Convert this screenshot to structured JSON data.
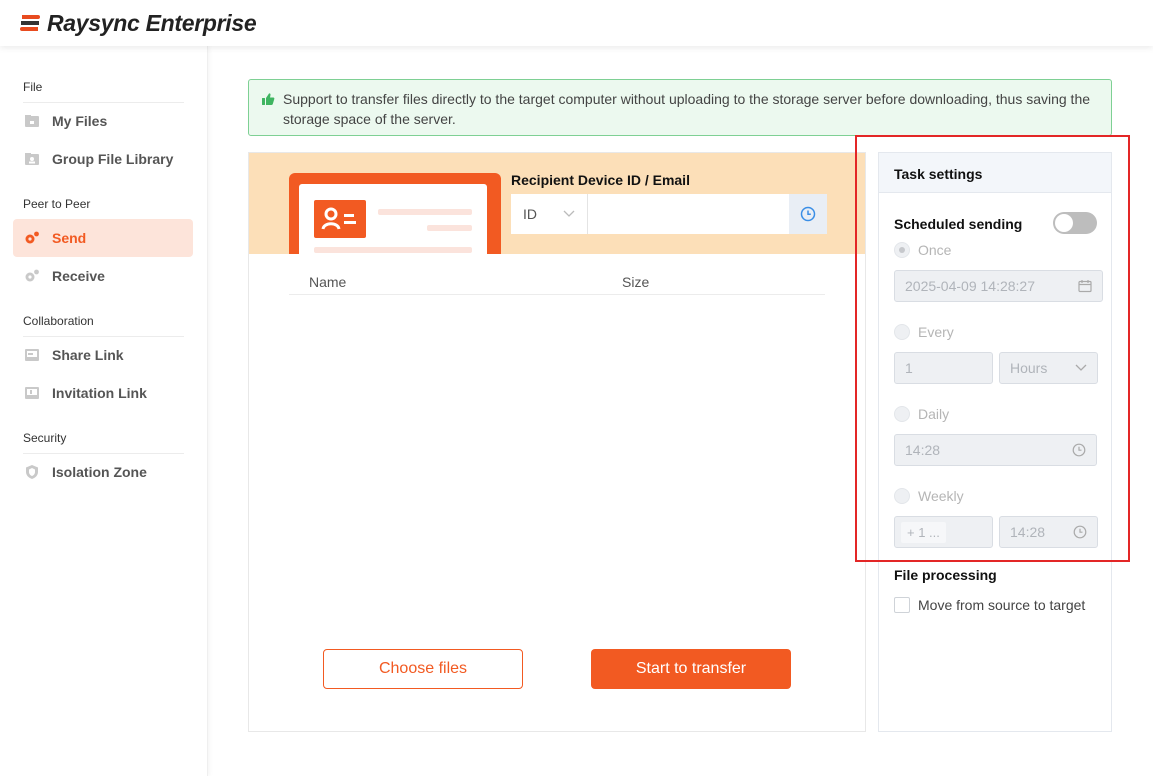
{
  "app": {
    "title": "Raysync Enterprise",
    "brand_color": "#f25a22"
  },
  "sidebar": {
    "sections": [
      {
        "label": "File"
      },
      {
        "label": "Peer to Peer"
      },
      {
        "label": "Collaboration"
      },
      {
        "label": "Security"
      }
    ],
    "items": [
      {
        "label": "My Files",
        "icon": "folder-icon"
      },
      {
        "label": "Group File Library",
        "icon": "group-folder-icon"
      },
      {
        "label": "Send",
        "icon": "send-gear-icon",
        "active": true
      },
      {
        "label": "Receive",
        "icon": "receive-gear-icon"
      },
      {
        "label": "Share Link",
        "icon": "share-link-icon"
      },
      {
        "label": "Invitation Link",
        "icon": "invitation-link-icon"
      },
      {
        "label": "Isolation Zone",
        "icon": "shield-icon"
      }
    ]
  },
  "banner": {
    "text": "Support to transfer files directly to the target computer without uploading to the storage server before downloading, thus saving the storage space of the server.",
    "icon": "thumbs-up-icon"
  },
  "send_panel": {
    "recipient_label": "Recipient Device ID / Email",
    "id_type": "ID",
    "recipient_value": "",
    "recipient_placeholder": "",
    "history_icon": "clock-icon",
    "columns": [
      "Name",
      "Size"
    ],
    "rows": [],
    "choose_files_label": "Choose files",
    "start_transfer_label": "Start to transfer"
  },
  "task_settings": {
    "title": "Task settings",
    "scheduled_sending_label": "Scheduled sending",
    "scheduled_sending_enabled": false,
    "options": {
      "once": {
        "label": "Once",
        "selected": true,
        "datetime": "2025-04-09 14:28:27"
      },
      "every": {
        "label": "Every",
        "selected": false,
        "interval": "1",
        "unit": "Hours"
      },
      "daily": {
        "label": "Daily",
        "selected": false,
        "time": "14:28"
      },
      "weekly": {
        "label": "Weekly",
        "selected": false,
        "days": "+ 1 ...",
        "time": "14:28"
      }
    },
    "file_processing_label": "File processing",
    "move_label": "Move from source to target",
    "move_checked": false
  }
}
